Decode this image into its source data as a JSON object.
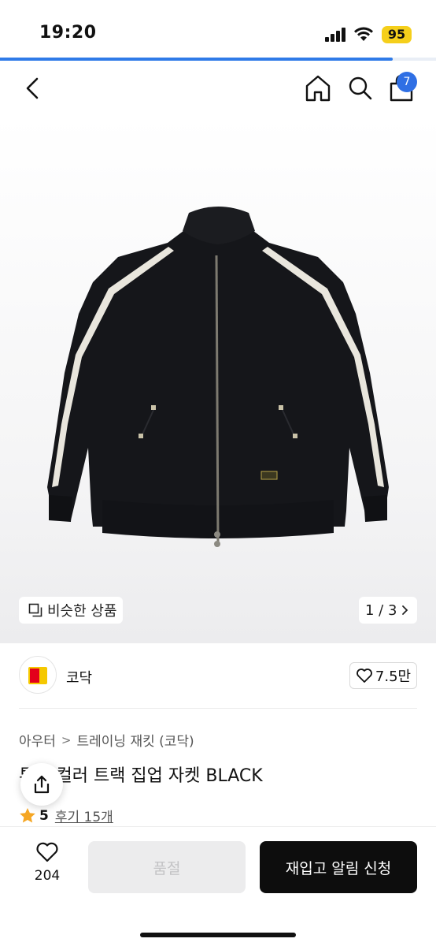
{
  "status_bar": {
    "time": "19:20",
    "battery": "95",
    "page_load_progress": 0.9
  },
  "nav": {
    "cart_count": "7",
    "icons": [
      "back-icon",
      "home-icon",
      "search-icon",
      "shopping-bag-icon"
    ]
  },
  "gallery": {
    "similar_label": "비슷한 상품",
    "page_indicator": "1 / 3",
    "image_description_icon": "jacket-image"
  },
  "brand": {
    "name": "코닥",
    "like_count": "7.5만"
  },
  "breadcrumb": [
    "아우터",
    "트레이닝 재킷 (코닥)"
  ],
  "product": {
    "title": "투톤 컬러 트랙 집업 자켓 BLACK",
    "rating": "5",
    "reviews": "후기 15개"
  },
  "bottom_bar": {
    "wish_count": "204",
    "soldout_label": "품절",
    "restock_label": "재입고 알림 신청"
  },
  "colors": {
    "accent_blue": "#2f6fe4",
    "battery_yellow": "#f5cf1b",
    "primary_button": "#0d0d0d",
    "disabled_button": "#ececed",
    "star": "#f5a623"
  }
}
